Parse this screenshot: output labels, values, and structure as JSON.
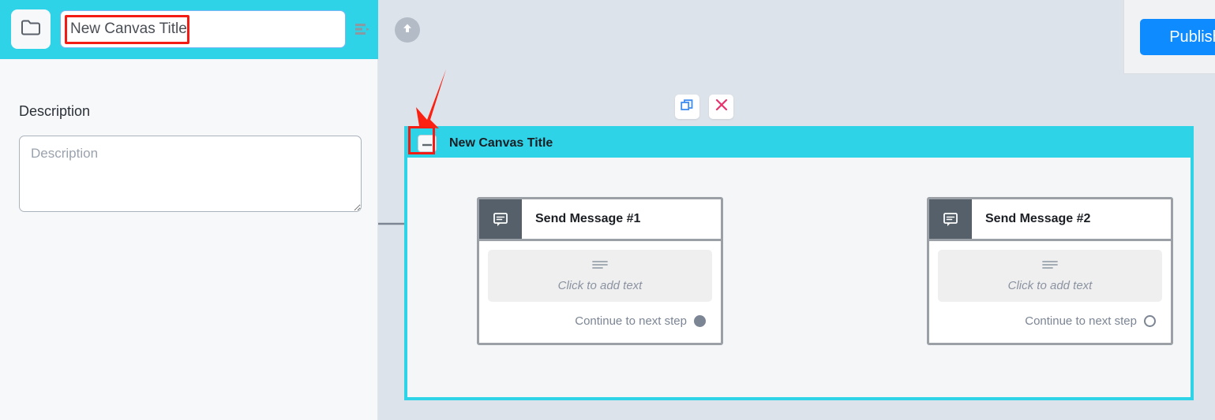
{
  "left_panel": {
    "folder_icon": "folder-icon",
    "title_value": "New Canvas Title",
    "title_placeholder": "New Canvas Title",
    "list_icon": "list-indent-icon",
    "description_label": "Description",
    "description_value": "",
    "description_placeholder": "Description"
  },
  "canvas": {
    "upload_icon": "upload-circle-icon",
    "publish_label": "Publish",
    "group_actions": {
      "duplicate_icon": "duplicate-icon",
      "close_icon": "close-x-icon"
    },
    "group": {
      "collapse_icon": "minus-icon",
      "title": "New Canvas Title"
    },
    "nodes": [
      {
        "icon": "message-bubble-icon",
        "title": "Send Message #1",
        "placeholder_icon": "text-lines-icon",
        "placeholder_text": "Click to add text",
        "footer_label": "Continue to next step",
        "connector": "filled"
      },
      {
        "icon": "message-bubble-icon",
        "title": "Send Message #2",
        "placeholder_icon": "text-lines-icon",
        "placeholder_text": "Click to add text",
        "footer_label": "Continue to next step",
        "connector": "empty"
      }
    ]
  },
  "annotations": {
    "arrow": "red-arrow-annotation",
    "title_box": "red-box-annotation",
    "collapse_box": "red-box-annotation"
  },
  "colors": {
    "brand_cyan": "#2fd3e8",
    "publish_blue": "#0d8bff",
    "annotation_red": "#f41b14",
    "canvas_bg": "#dde3ea",
    "node_icon_bg": "#56606b",
    "close_pink": "#e8336d"
  }
}
